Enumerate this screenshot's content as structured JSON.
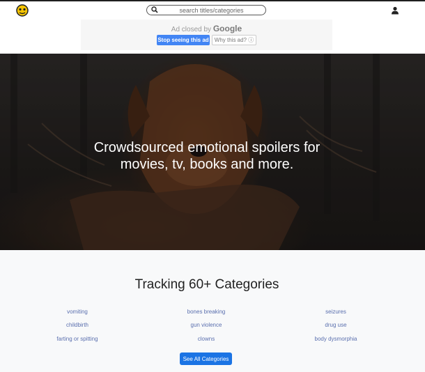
{
  "search": {
    "placeholder": "search titles/categories"
  },
  "ad": {
    "closed_by": "Ad closed by",
    "brand": "Google",
    "stop_label": "Stop seeing this ad",
    "why_label": "Why this ad? ⓘ"
  },
  "hero": {
    "title_line1": "Crowdsourced emotional spoilers for",
    "title_line2": "movies, tv, books and more."
  },
  "categories": {
    "title": "Tracking 60+ Categories",
    "items": [
      "vomiting",
      "bones breaking",
      "seizures",
      "childbirth",
      "gun violence",
      "drug use",
      "farting or spitting",
      "clowns",
      "body dysmorphia"
    ],
    "button_label": "See All Categories"
  },
  "colors": {
    "accent": "#1b74e4",
    "link": "#5a6fae",
    "hero_text": "#ffffff"
  },
  "icons": [
    "logo-face-icon",
    "search-icon",
    "user-icon"
  ]
}
